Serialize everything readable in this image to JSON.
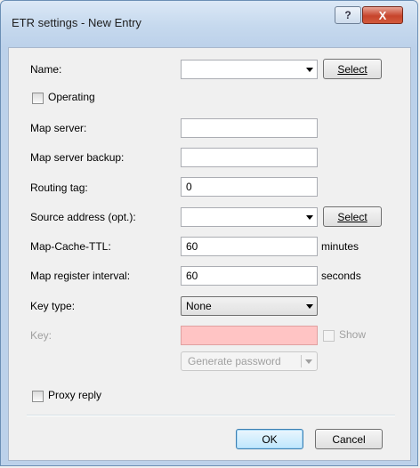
{
  "window": {
    "title": "ETR settings - New Entry",
    "help_glyph": "?",
    "close_glyph": "X"
  },
  "form": {
    "name": {
      "label": "Name:",
      "value": "",
      "select_button": "Select"
    },
    "operating": {
      "label": "Operating",
      "checked": false
    },
    "map_server": {
      "label": "Map server:",
      "value": ""
    },
    "map_server_backup": {
      "label": "Map server backup:",
      "value": ""
    },
    "routing_tag": {
      "label": "Routing tag:",
      "value": "0"
    },
    "source_address": {
      "label": "Source address (opt.):",
      "value": "",
      "select_button": "Select"
    },
    "map_cache_ttl": {
      "label": "Map-Cache-TTL:",
      "value": "60",
      "unit": "minutes"
    },
    "map_register_interval": {
      "label": "Map register interval:",
      "value": "60",
      "unit": "seconds"
    },
    "key_type": {
      "label": "Key type:",
      "value": "None"
    },
    "key": {
      "label": "Key:",
      "value": "",
      "show_label": "Show",
      "error_color": "#ffc4c4"
    },
    "generate_password": {
      "label": "Generate password"
    },
    "proxy_reply": {
      "label": "Proxy reply",
      "checked": false
    }
  },
  "footer": {
    "ok_label": "OK",
    "cancel_label": "Cancel"
  },
  "colors": {
    "accent": "#3c7fb1",
    "close": "#c7442c"
  }
}
